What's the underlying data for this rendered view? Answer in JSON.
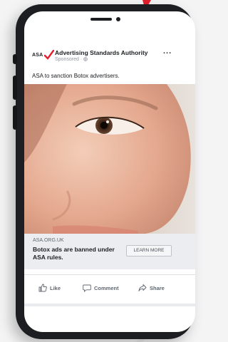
{
  "post": {
    "logo_text": "ASA",
    "page_name": "Advertising Standards Authority",
    "sponsored": "Sponsored · ",
    "more": "...",
    "caption": "ASA to sanction Botox advertisers.",
    "link_domain": "ASA.ORG.UK",
    "link_title": "Botox ads are banned under ASA rules.",
    "cta_label": "LEARN MORE"
  },
  "actions": {
    "like": "Like",
    "comment": "Comment",
    "share": "Share"
  },
  "colors": {
    "brand_red": "#e4202e",
    "phone_body": "#1d1e21",
    "link_box_bg": "#ebedf0"
  }
}
